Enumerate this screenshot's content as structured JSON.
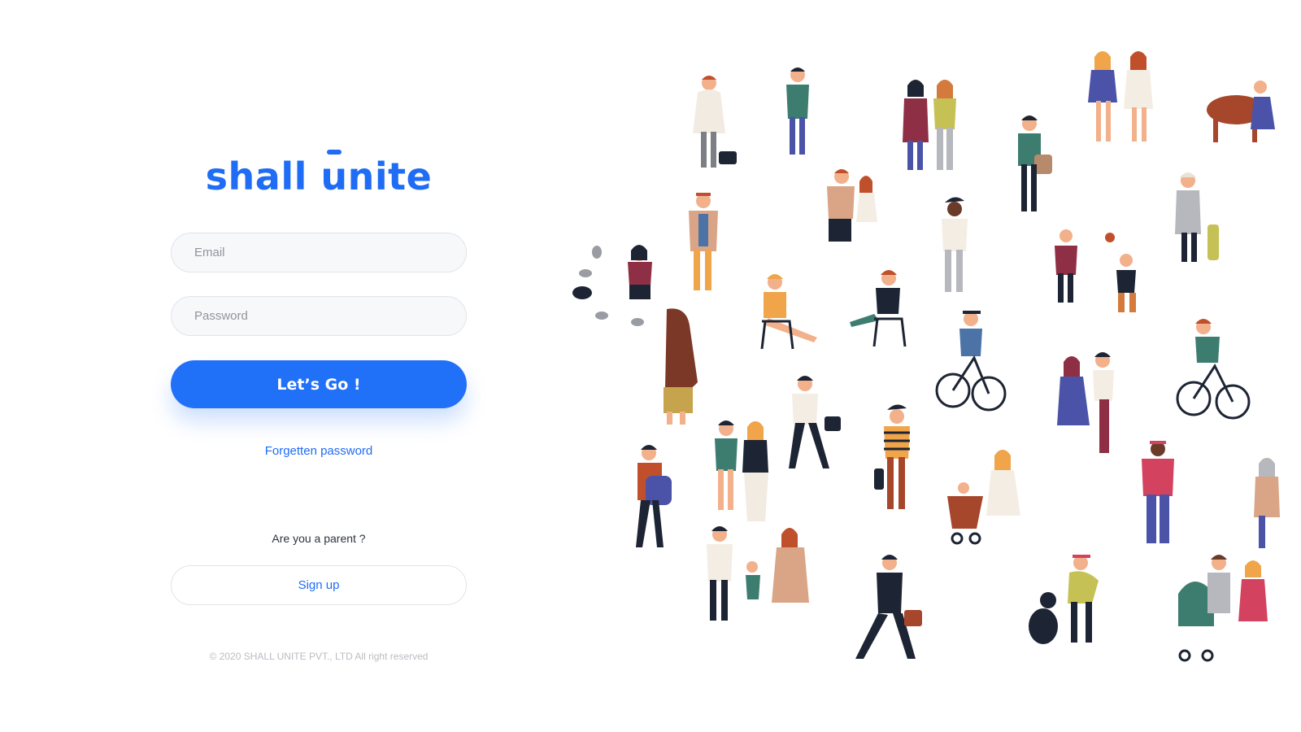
{
  "brand": {
    "logo_text_left": "shall ",
    "logo_text_u": "u",
    "logo_text_right": "nite",
    "color": "#1f6cf5"
  },
  "login": {
    "email_placeholder": "Email",
    "password_placeholder": "Password",
    "submit_label": "Let’s Go !",
    "forgot_label": "Forgetten password"
  },
  "signup": {
    "question": "Are you a parent ?",
    "button_label": "Sign up"
  },
  "footer": {
    "copyright": "© 2020 SHALL UNITE PVT., LTD All right reserved"
  },
  "illustration": {
    "icon": "crowd-of-people-illustration"
  }
}
